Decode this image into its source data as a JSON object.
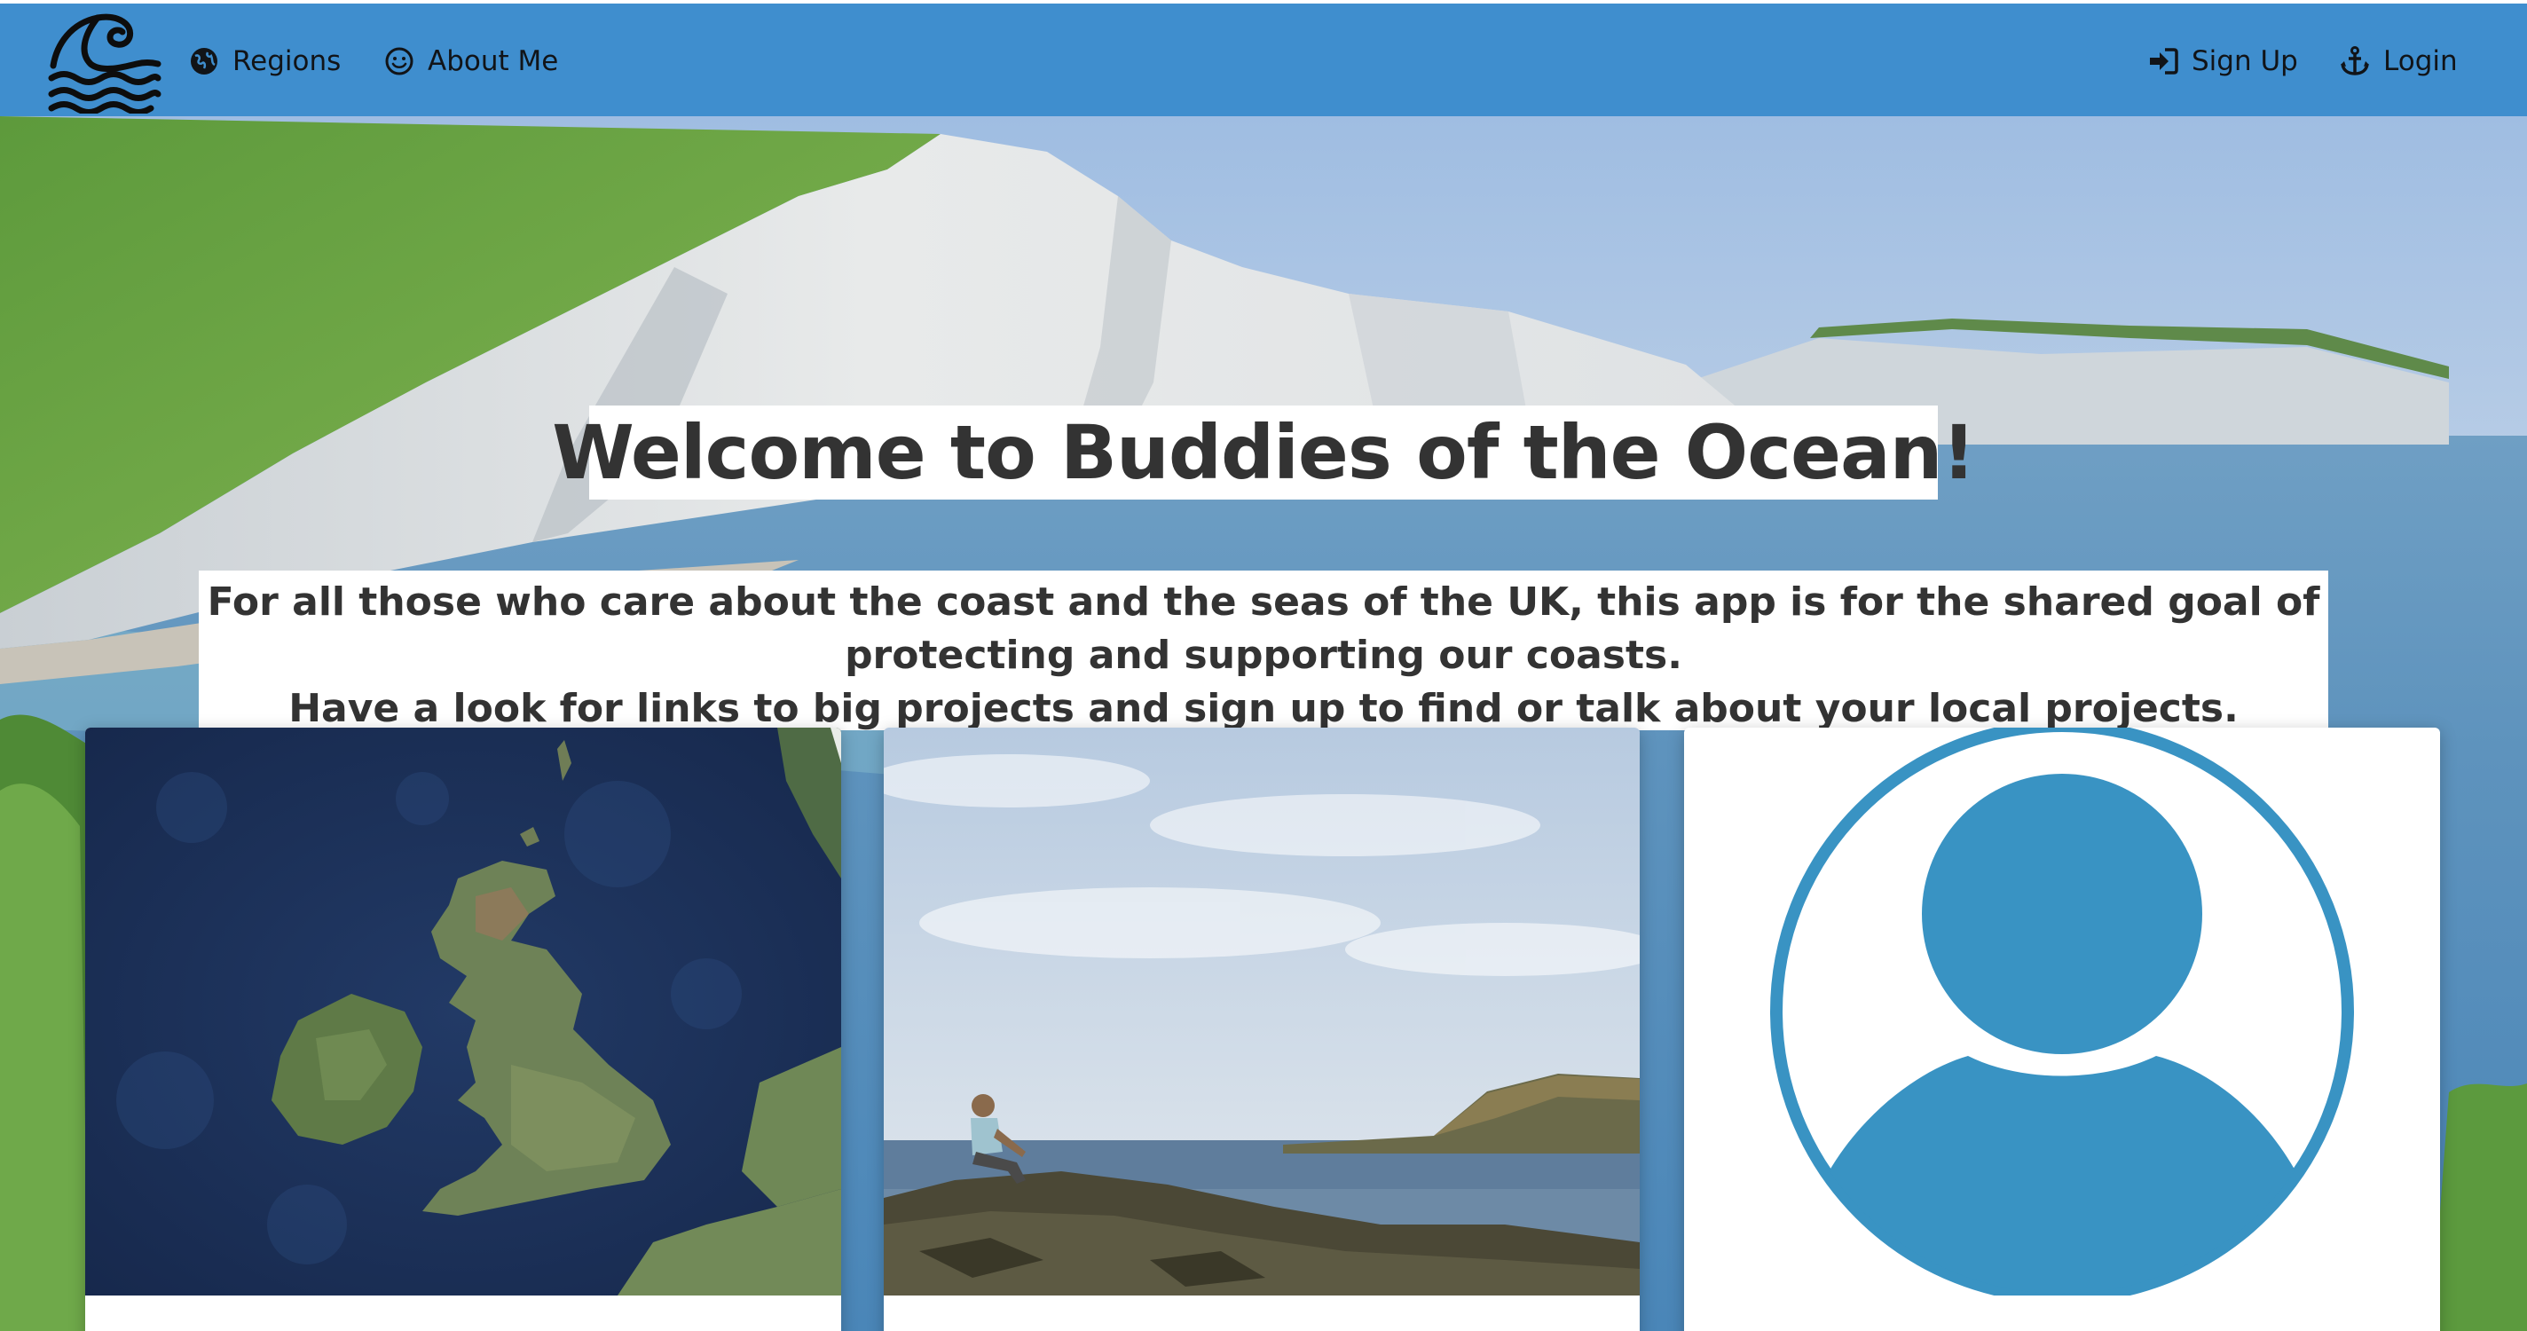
{
  "navbar": {
    "brand_icon": "wave-logo-icon",
    "items_left": [
      {
        "label": "Regions",
        "icon": "globe-icon"
      },
      {
        "label": "About Me",
        "icon": "smile-icon"
      }
    ],
    "items_right": [
      {
        "label": "Sign Up",
        "icon": "sign-in-icon"
      },
      {
        "label": "Login",
        "icon": "anchor-icon"
      }
    ]
  },
  "hero": {
    "title": "Welcome to Buddies of the Ocean!",
    "intro_line_1": "For all those who care about the coast and the seas of the UK, this app is for the shared goal of protecting and supporting our coasts.",
    "intro_line_2": "Have a look for links to big projects and sign up to find or talk about your local projects."
  },
  "cards": [
    {
      "image": "uk-satellite-map"
    },
    {
      "image": "person-sitting-on-coastal-rocks"
    },
    {
      "image": "user-avatar-icon"
    }
  ],
  "colors": {
    "navbar": "#3f8ece",
    "text": "#333333",
    "avatar": "#3993c3"
  }
}
